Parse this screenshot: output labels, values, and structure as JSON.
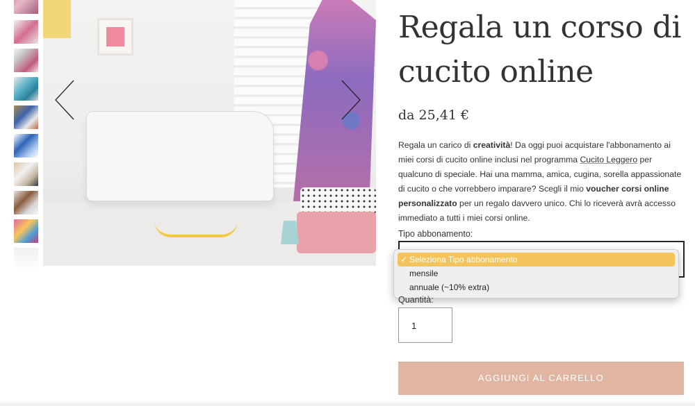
{
  "product": {
    "title": "Regala un corso di cucito online",
    "price": "da 25,41 €",
    "description": {
      "p1": "Regala un carico di ",
      "b1": "creatività",
      "p2": "! Da oggi puoi acquistare l'abbonamento ai miei corsi di cucito online inclusi nel programma ",
      "link": "Cucito Leggero",
      "p3": " per qualcuno di speciale. Hai una mamma, amica, cugina, sorella appassionate di cucito o che vorrebbero imparare? Scegli il mio ",
      "b2": "voucher corsi online personalizzato",
      "p4": " per un regalo davvero unico. Chi lo riceverà avrà accesso immediato a tutti i miei corsi online."
    }
  },
  "gallery": {
    "thumbnail_count": 10,
    "prev_icon": "chevron-left-icon",
    "next_icon": "chevron-right-icon"
  },
  "subscription": {
    "label": "Tipo abbonamento:",
    "options": [
      {
        "label": "Seleziona Tipo abbonamento",
        "selected": true
      },
      {
        "label": "mensile",
        "selected": false
      },
      {
        "label": "annuale (~10% extra)",
        "selected": false
      }
    ],
    "check_mark": "✓"
  },
  "quantity": {
    "label": "Quantità:",
    "value": "1"
  },
  "cart": {
    "button_label": "AGGIUNGI AL CARRELLO"
  },
  "colors": {
    "accent_button": "#e0b5a2",
    "dropdown_highlight": "#f2c45b"
  }
}
